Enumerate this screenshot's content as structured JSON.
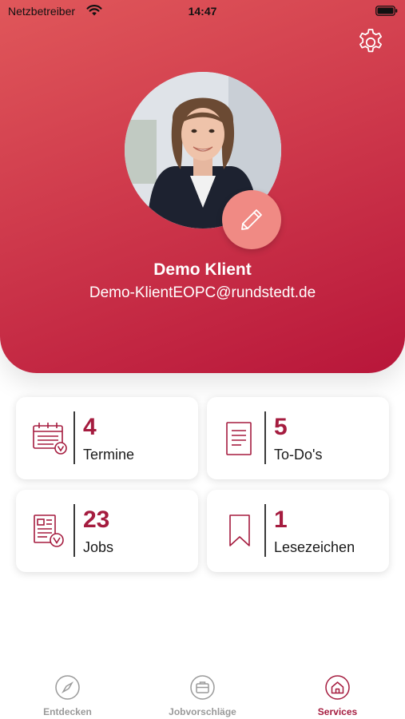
{
  "status_bar": {
    "carrier": "Netzbetreiber",
    "time": "14:47"
  },
  "profile": {
    "name": "Demo Klient",
    "email": "Demo-KlientEOPC@rundstedt.de"
  },
  "cards": [
    {
      "count": "4",
      "label": "Termine",
      "icon": "calendar-icon"
    },
    {
      "count": "5",
      "label": "To-Do's",
      "icon": "document-icon"
    },
    {
      "count": "23",
      "label": "Jobs",
      "icon": "job-check-icon"
    },
    {
      "count": "1",
      "label": "Lesezeichen",
      "icon": "bookmark-icon"
    }
  ],
  "tabs": [
    {
      "label": "Entdecken",
      "icon": "compass-icon",
      "active": false
    },
    {
      "label": "Jobvorschläge",
      "icon": "briefcase-icon",
      "active": false
    },
    {
      "label": "Services",
      "icon": "home-icon",
      "active": true
    }
  ],
  "colors": {
    "accent": "#a51c3f",
    "header_top": "#e0575a",
    "header_bottom": "#b8163a",
    "edit_button": "#f08a84",
    "inactive_tab": "#9a9a9a"
  }
}
